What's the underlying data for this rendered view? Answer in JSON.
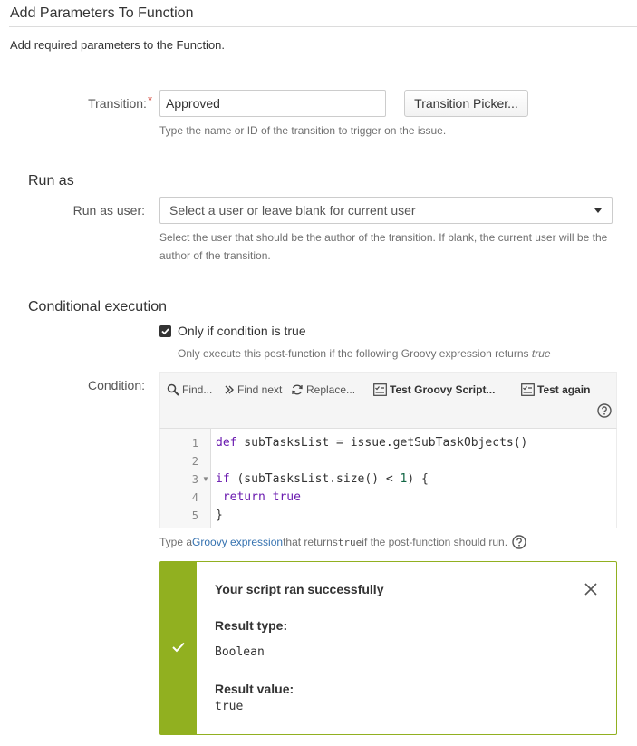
{
  "page": {
    "title": "Add Parameters To Function",
    "description": "Add required parameters to the Function."
  },
  "transition": {
    "label": "Transition:",
    "required_marker": "*",
    "value": "Approved",
    "picker_button": "Transition Picker...",
    "help": "Type the name or ID of the transition to trigger on the issue."
  },
  "run_as": {
    "section_title": "Run as",
    "label": "Run as user:",
    "select_placeholder": "Select a user or leave blank for current user",
    "help_line1": "Select the user that should be the author of the transition. If blank, the current user will be the",
    "help_line2": "author of the transition."
  },
  "conditional": {
    "section_title": "Conditional execution",
    "checkbox_label": "Only if condition is true",
    "checkbox_checked": true,
    "help_prefix": "Only execute this post-function if the following Groovy expression returns ",
    "help_emph": "true",
    "condition_label": "Condition:"
  },
  "toolbar": {
    "find": "Find...",
    "find_next": "Find next",
    "replace": "Replace...",
    "test_script": "Test Groovy Script...",
    "test_again": "Test again"
  },
  "editor": {
    "line_numbers": [
      "1",
      "2",
      "3",
      "4",
      "5"
    ],
    "lines": {
      "l1_kw": "def",
      "l1_rest": " subTasksList = issue.getSubTaskObjects()",
      "l3_kw": "if",
      "l3_mid": " (subTasksList.size() < ",
      "l3_num": "1",
      "l3_end": ") {",
      "l4_kw": "return",
      "l4_val": "true",
      "l5": "}"
    }
  },
  "code_help": {
    "prefix": "Type a ",
    "link": "Groovy expression",
    "middle": " that returns ",
    "code": "true",
    "suffix": " if the post-function should run."
  },
  "result": {
    "title": "Your script ran successfully",
    "type_label": "Result type:",
    "type_value": "Boolean",
    "value_label": "Result value:",
    "value": "true",
    "success_color": "#91b020"
  }
}
